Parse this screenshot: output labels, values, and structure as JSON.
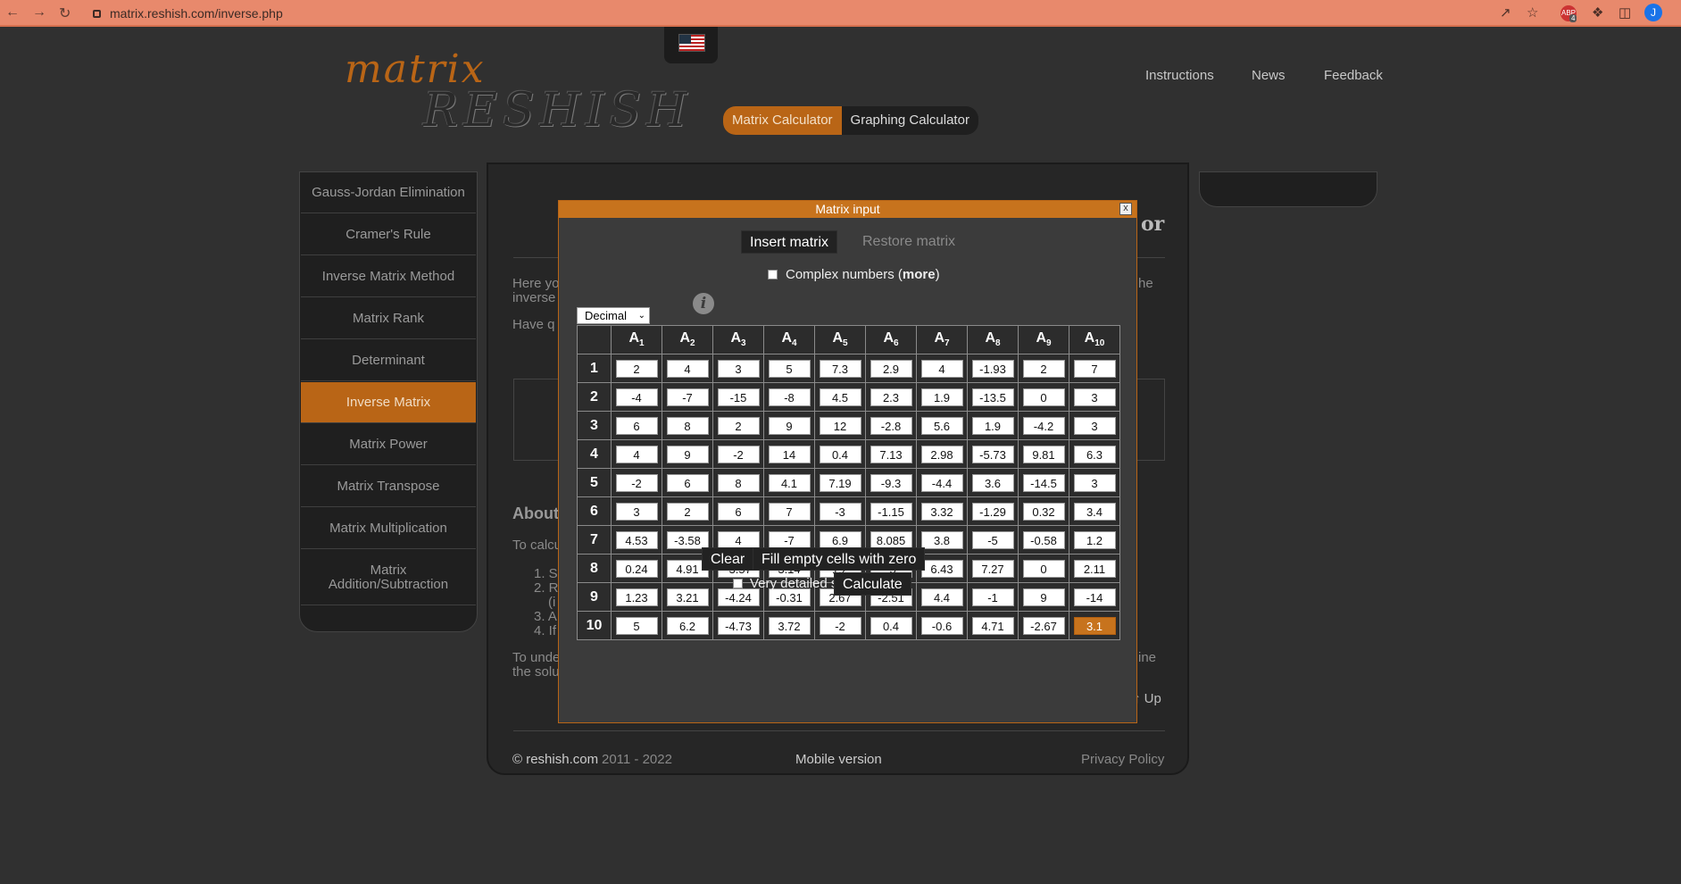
{
  "browser": {
    "url": "matrix.reshish.com/inverse.php",
    "avatar": "J",
    "ext_badge": "4"
  },
  "logo": {
    "line1": "matrix",
    "line2": "RESHISH"
  },
  "topnav": [
    "Instructions",
    "News",
    "Feedback"
  ],
  "calc_tabs": [
    "Matrix Calculator",
    "Graphing Calculator"
  ],
  "sidebar": [
    "Gauss-Jordan Elimination",
    "Cramer's Rule",
    "Inverse Matrix Method",
    "Matrix Rank",
    "Determinant",
    "Inverse Matrix",
    "Matrix Power",
    "Matrix Transpose",
    "Matrix Multiplication",
    "Matrix Addition/Subtraction"
  ],
  "sidebar_active": 5,
  "background": {
    "title_fragment": "or",
    "here": "Here yo",
    "inverse": "inverse",
    "have": "Have q",
    "about": "About",
    "to_calc": "To calcu",
    "steps": [
      "1. S",
      "2. R",
      "(i",
      "3. A",
      "4. If"
    ],
    "to_under": "To unde",
    "the_sol": "the solu",
    "right1": "he",
    "right2": "ine",
    "up": "↑ Up"
  },
  "footer": {
    "copy": "© reshish.com",
    "years": "2011 - 2022",
    "mobile": "Mobile version",
    "privacy": "Privacy Policy"
  },
  "modal": {
    "title": "Matrix input",
    "close": "x",
    "insert": "Insert matrix",
    "restore": "Restore matrix",
    "complex": "Complex numbers",
    "more": "more",
    "format": "Decimal",
    "info": "i",
    "col_prefix": "A",
    "clear": "Clear",
    "fill": "Fill empty cells with zero",
    "detailed": "Very detailed solution",
    "calculate": "Calculate",
    "matrix": [
      [
        "2",
        "4",
        "3",
        "5",
        "7.3",
        "2.9",
        "4",
        "-1.93",
        "2",
        "7"
      ],
      [
        "-4",
        "-7",
        "-15",
        "-8",
        "4.5",
        "2.3",
        "1.9",
        "-13.5",
        "0",
        "3"
      ],
      [
        "6",
        "8",
        "2",
        "9",
        "12",
        "-2.8",
        "5.6",
        "1.9",
        "-4.2",
        "3"
      ],
      [
        "4",
        "9",
        "-2",
        "14",
        "0.4",
        "7.13",
        "2.98",
        "-5.73",
        "9.81",
        "6.3"
      ],
      [
        "-2",
        "6",
        "8",
        "4.1",
        "7.19",
        "-9.3",
        "-4.4",
        "3.6",
        "-14.5",
        "3"
      ],
      [
        "3",
        "2",
        "6",
        "7",
        "-3",
        "-1.15",
        "3.32",
        "-1.29",
        "0.32",
        "3.4"
      ],
      [
        "4.53",
        "-3.58",
        "4",
        "-7",
        "6.9",
        "8.085",
        "3.8",
        "-5",
        "-0.58",
        "1.2"
      ],
      [
        "0.24",
        "4.91",
        "-3.57",
        "3.14",
        "1.2",
        "-5",
        "6.43",
        "7.27",
        "0",
        "2.11"
      ],
      [
        "1.23",
        "3.21",
        "-4.24",
        "-0.31",
        "2.67",
        "-2.51",
        "4.4",
        "-1",
        "9",
        "-14"
      ],
      [
        "5",
        "6.2",
        "-4.73",
        "3.72",
        "-2",
        "0.4",
        "-0.6",
        "4.71",
        "-2.67",
        "3.1"
      ]
    ]
  },
  "colors": {
    "accent": "#c7731d",
    "bg": "#303030"
  }
}
